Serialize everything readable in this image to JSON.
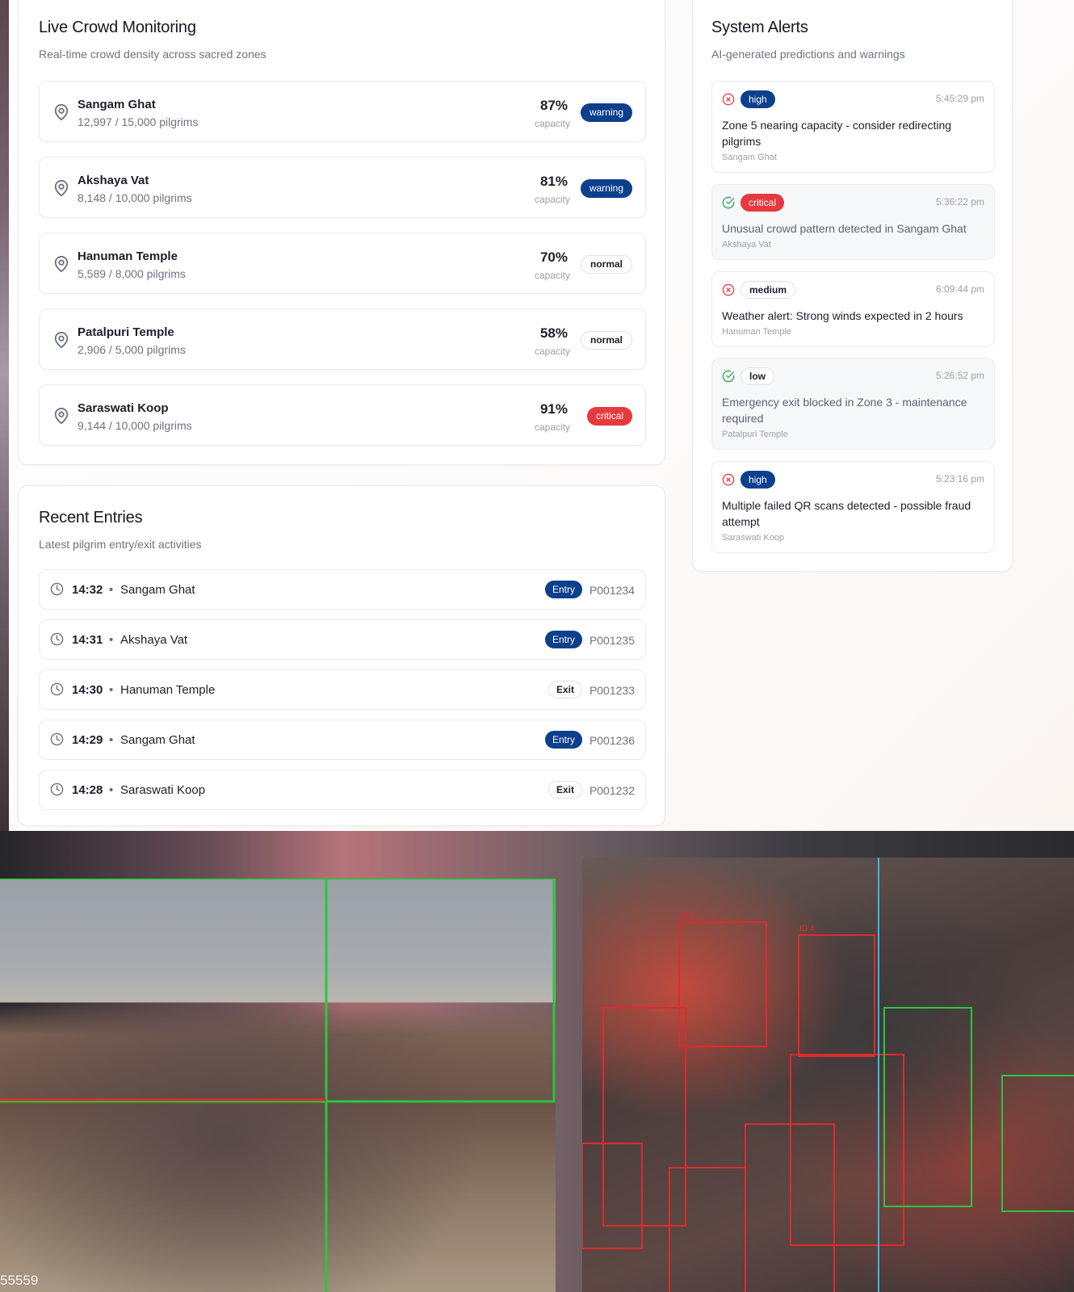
{
  "zones": {
    "title": "Live Crowd Monitoring",
    "subtitle": "Real-time crowd density across sacred zones",
    "capacity_label": "capacity",
    "items": [
      {
        "name": "Sangam Ghat",
        "count": "12,997 / 15,000 pilgrims",
        "percent": "87%",
        "status": "warning"
      },
      {
        "name": "Akshaya Vat",
        "count": "8,148 / 10,000 pilgrims",
        "percent": "81%",
        "status": "warning"
      },
      {
        "name": "Hanuman Temple",
        "count": "5,589 / 8,000 pilgrims",
        "percent": "70%",
        "status": "normal"
      },
      {
        "name": "Patalpuri Temple",
        "count": "2,906 / 5,000 pilgrims",
        "percent": "58%",
        "status": "normal"
      },
      {
        "name": "Saraswati Koop",
        "count": "9,144 / 10,000 pilgrims",
        "percent": "91%",
        "status": "critical"
      }
    ]
  },
  "entries": {
    "title": "Recent Entries",
    "subtitle": "Latest pilgrim entry/exit activities",
    "separator": "•",
    "items": [
      {
        "time": "14:32",
        "place": "Sangam Ghat",
        "type": "Entry",
        "id": "P001234"
      },
      {
        "time": "14:31",
        "place": "Akshaya Vat",
        "type": "Entry",
        "id": "P001235"
      },
      {
        "time": "14:30",
        "place": "Hanuman Temple",
        "type": "Exit",
        "id": "P001233"
      },
      {
        "time": "14:29",
        "place": "Sangam Ghat",
        "type": "Entry",
        "id": "P001236"
      },
      {
        "time": "14:28",
        "place": "Saraswati Koop",
        "type": "Exit",
        "id": "P001232"
      }
    ]
  },
  "alerts": {
    "title": "System Alerts",
    "subtitle": "AI-generated predictions and warnings",
    "items": [
      {
        "severity": "high",
        "time": "5:45:29 pm",
        "message": "Zone 5 nearing capacity - consider redirecting pilgrims",
        "location": "Sangam Ghat",
        "icon": "x-circle-icon",
        "resolved": false
      },
      {
        "severity": "critical",
        "time": "5:36:22 pm",
        "message": "Unusual crowd pattern detected in Sangam Ghat",
        "location": "Akshaya Vat",
        "icon": "check-circle-icon",
        "resolved": true
      },
      {
        "severity": "medium",
        "time": "6:09:44 pm",
        "message": "Weather alert: Strong winds expected in 2 hours",
        "location": "Hanuman Temple",
        "icon": "x-circle-icon",
        "resolved": false
      },
      {
        "severity": "low",
        "time": "5:26:52 pm",
        "message": "Emergency exit blocked in Zone 3 - maintenance required",
        "location": "Patalpuri Temple",
        "icon": "check-circle-icon",
        "resolved": true
      },
      {
        "severity": "high",
        "time": "5:23:16 pm",
        "message": "Multiple failed QR scans detected - possible fraud attempt",
        "location": "Saraswati Koop",
        "icon": "x-circle-icon",
        "resolved": false
      }
    ]
  },
  "feeds": {
    "left_counter": "55559",
    "right_box_labels": [
      "ID 3",
      "ID 4"
    ]
  },
  "colors": {
    "navy": "#0c3f8c",
    "critical_red": "#e53a3f",
    "alert_x": "#e0434a",
    "alert_check": "#2fa65a",
    "detect_green": "#28c83a",
    "detect_red": "#e02a2a"
  }
}
